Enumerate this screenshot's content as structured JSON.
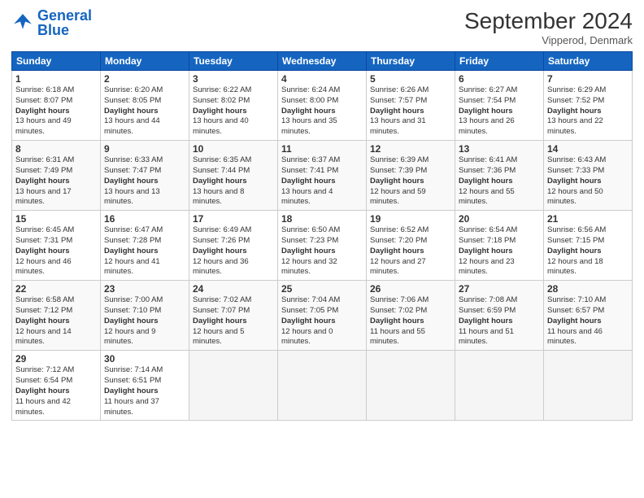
{
  "header": {
    "logo_general": "General",
    "logo_blue": "Blue",
    "month_title": "September 2024",
    "location": "Vipperod, Denmark"
  },
  "days_of_week": [
    "Sunday",
    "Monday",
    "Tuesday",
    "Wednesday",
    "Thursday",
    "Friday",
    "Saturday"
  ],
  "weeks": [
    [
      {
        "day": "1",
        "sunrise": "Sunrise: 6:18 AM",
        "sunset": "Sunset: 8:07 PM",
        "daylight": "Daylight: 13 hours and 49 minutes."
      },
      {
        "day": "2",
        "sunrise": "Sunrise: 6:20 AM",
        "sunset": "Sunset: 8:05 PM",
        "daylight": "Daylight: 13 hours and 44 minutes."
      },
      {
        "day": "3",
        "sunrise": "Sunrise: 6:22 AM",
        "sunset": "Sunset: 8:02 PM",
        "daylight": "Daylight: 13 hours and 40 minutes."
      },
      {
        "day": "4",
        "sunrise": "Sunrise: 6:24 AM",
        "sunset": "Sunset: 8:00 PM",
        "daylight": "Daylight: 13 hours and 35 minutes."
      },
      {
        "day": "5",
        "sunrise": "Sunrise: 6:26 AM",
        "sunset": "Sunset: 7:57 PM",
        "daylight": "Daylight: 13 hours and 31 minutes."
      },
      {
        "day": "6",
        "sunrise": "Sunrise: 6:27 AM",
        "sunset": "Sunset: 7:54 PM",
        "daylight": "Daylight: 13 hours and 26 minutes."
      },
      {
        "day": "7",
        "sunrise": "Sunrise: 6:29 AM",
        "sunset": "Sunset: 7:52 PM",
        "daylight": "Daylight: 13 hours and 22 minutes."
      }
    ],
    [
      {
        "day": "8",
        "sunrise": "Sunrise: 6:31 AM",
        "sunset": "Sunset: 7:49 PM",
        "daylight": "Daylight: 13 hours and 17 minutes."
      },
      {
        "day": "9",
        "sunrise": "Sunrise: 6:33 AM",
        "sunset": "Sunset: 7:47 PM",
        "daylight": "Daylight: 13 hours and 13 minutes."
      },
      {
        "day": "10",
        "sunrise": "Sunrise: 6:35 AM",
        "sunset": "Sunset: 7:44 PM",
        "daylight": "Daylight: 13 hours and 8 minutes."
      },
      {
        "day": "11",
        "sunrise": "Sunrise: 6:37 AM",
        "sunset": "Sunset: 7:41 PM",
        "daylight": "Daylight: 13 hours and 4 minutes."
      },
      {
        "day": "12",
        "sunrise": "Sunrise: 6:39 AM",
        "sunset": "Sunset: 7:39 PM",
        "daylight": "Daylight: 12 hours and 59 minutes."
      },
      {
        "day": "13",
        "sunrise": "Sunrise: 6:41 AM",
        "sunset": "Sunset: 7:36 PM",
        "daylight": "Daylight: 12 hours and 55 minutes."
      },
      {
        "day": "14",
        "sunrise": "Sunrise: 6:43 AM",
        "sunset": "Sunset: 7:33 PM",
        "daylight": "Daylight: 12 hours and 50 minutes."
      }
    ],
    [
      {
        "day": "15",
        "sunrise": "Sunrise: 6:45 AM",
        "sunset": "Sunset: 7:31 PM",
        "daylight": "Daylight: 12 hours and 46 minutes."
      },
      {
        "day": "16",
        "sunrise": "Sunrise: 6:47 AM",
        "sunset": "Sunset: 7:28 PM",
        "daylight": "Daylight: 12 hours and 41 minutes."
      },
      {
        "day": "17",
        "sunrise": "Sunrise: 6:49 AM",
        "sunset": "Sunset: 7:26 PM",
        "daylight": "Daylight: 12 hours and 36 minutes."
      },
      {
        "day": "18",
        "sunrise": "Sunrise: 6:50 AM",
        "sunset": "Sunset: 7:23 PM",
        "daylight": "Daylight: 12 hours and 32 minutes."
      },
      {
        "day": "19",
        "sunrise": "Sunrise: 6:52 AM",
        "sunset": "Sunset: 7:20 PM",
        "daylight": "Daylight: 12 hours and 27 minutes."
      },
      {
        "day": "20",
        "sunrise": "Sunrise: 6:54 AM",
        "sunset": "Sunset: 7:18 PM",
        "daylight": "Daylight: 12 hours and 23 minutes."
      },
      {
        "day": "21",
        "sunrise": "Sunrise: 6:56 AM",
        "sunset": "Sunset: 7:15 PM",
        "daylight": "Daylight: 12 hours and 18 minutes."
      }
    ],
    [
      {
        "day": "22",
        "sunrise": "Sunrise: 6:58 AM",
        "sunset": "Sunset: 7:12 PM",
        "daylight": "Daylight: 12 hours and 14 minutes."
      },
      {
        "day": "23",
        "sunrise": "Sunrise: 7:00 AM",
        "sunset": "Sunset: 7:10 PM",
        "daylight": "Daylight: 12 hours and 9 minutes."
      },
      {
        "day": "24",
        "sunrise": "Sunrise: 7:02 AM",
        "sunset": "Sunset: 7:07 PM",
        "daylight": "Daylight: 12 hours and 5 minutes."
      },
      {
        "day": "25",
        "sunrise": "Sunrise: 7:04 AM",
        "sunset": "Sunset: 7:05 PM",
        "daylight": "Daylight: 12 hours and 0 minutes."
      },
      {
        "day": "26",
        "sunrise": "Sunrise: 7:06 AM",
        "sunset": "Sunset: 7:02 PM",
        "daylight": "Daylight: 11 hours and 55 minutes."
      },
      {
        "day": "27",
        "sunrise": "Sunrise: 7:08 AM",
        "sunset": "Sunset: 6:59 PM",
        "daylight": "Daylight: 11 hours and 51 minutes."
      },
      {
        "day": "28",
        "sunrise": "Sunrise: 7:10 AM",
        "sunset": "Sunset: 6:57 PM",
        "daylight": "Daylight: 11 hours and 46 minutes."
      }
    ],
    [
      {
        "day": "29",
        "sunrise": "Sunrise: 7:12 AM",
        "sunset": "Sunset: 6:54 PM",
        "daylight": "Daylight: 11 hours and 42 minutes."
      },
      {
        "day": "30",
        "sunrise": "Sunrise: 7:14 AM",
        "sunset": "Sunset: 6:51 PM",
        "daylight": "Daylight: 11 hours and 37 minutes."
      },
      null,
      null,
      null,
      null,
      null
    ]
  ]
}
